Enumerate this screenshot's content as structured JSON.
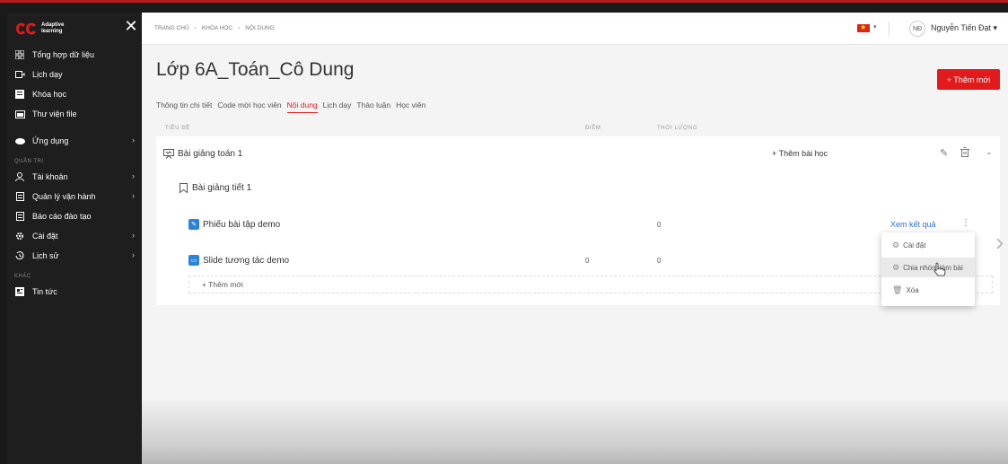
{
  "brand": {
    "logo_text_line1": "Adaptive",
    "logo_text_line2": "learning",
    "accent": "#e11b1b"
  },
  "sidebar": {
    "items": [
      {
        "label": "Tổng hợp dữ liệu",
        "icon": "grid-icon"
      },
      {
        "label": "Lịch dạy",
        "icon": "video-icon"
      },
      {
        "label": "Khóa học",
        "icon": "book-icon"
      },
      {
        "label": "Thư viện file",
        "icon": "folder-icon"
      },
      {
        "label": "Ứng dụng",
        "icon": "app-icon"
      }
    ],
    "section_admin": "QUẢN TRỊ",
    "admin_items": [
      {
        "label": "Tài khoản",
        "icon": "user-icon"
      },
      {
        "label": "Quản lý vận hành",
        "icon": "document-icon"
      },
      {
        "label": "Báo cáo đào tạo",
        "icon": "report-icon"
      },
      {
        "label": "Cài đặt",
        "icon": "settings-icon"
      },
      {
        "label": "Lịch sử",
        "icon": "history-icon"
      }
    ],
    "section_other": "KHÁC",
    "other_items": [
      {
        "label": "Tin tức",
        "icon": "news-icon"
      }
    ]
  },
  "topbar": {
    "breadcrumb": [
      "TRANG CHỦ",
      "KHÓA HỌC",
      "NỘI DUNG"
    ],
    "avatar_initials": "NĐ",
    "user_name": "Nguyễn Tiến Đạt ▾"
  },
  "page": {
    "title": "Lớp 6A_Toán_Cô Dung",
    "add_button": "+ Thêm mới",
    "tabs": [
      "Thông tin chi tiết",
      "Code mời học viên",
      "Nội dung",
      "Lịch dạy",
      "Thảo luận",
      "Học viên"
    ],
    "active_tab": 2
  },
  "table": {
    "headers": {
      "title": "TIÊU ĐỀ",
      "score": "ĐIỂM",
      "duration": "THỜI LƯỢNG"
    },
    "chapter": {
      "title": "Bài giảng toán 1",
      "add_lesson": "+ Thêm bài học"
    },
    "lesson": {
      "title": "Bài giảng tiết 1"
    },
    "items": [
      {
        "title": "Phiếu bài tập demo",
        "score": "",
        "duration": "0",
        "action": "Xem kết quả"
      },
      {
        "title": "Slide tương tác demo",
        "score": "0",
        "duration": "0",
        "action": ""
      }
    ],
    "add_row": "+ Thêm mới"
  },
  "context_menu": {
    "items": [
      "Cài đặt",
      "Chia nhóm làm bài",
      "Xóa"
    ],
    "highlighted": 1
  }
}
